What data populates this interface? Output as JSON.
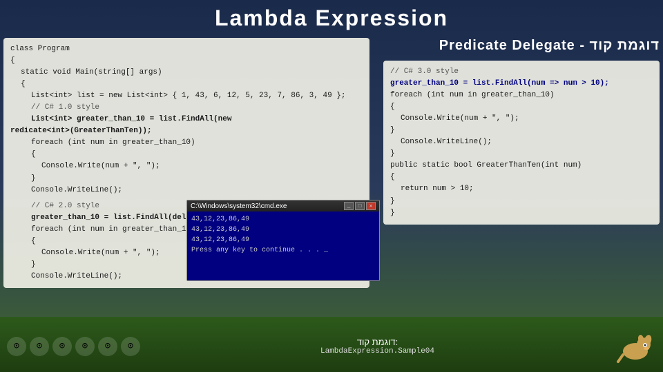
{
  "title": "Lambda  Expression",
  "predicate_header": "Predicate Delegate - דוגמת קוד",
  "left_code": {
    "lines": [
      {
        "text": "class Program",
        "indent": 0,
        "bold": false
      },
      {
        "text": "{",
        "indent": 0,
        "bold": false
      },
      {
        "text": "static void Main(string[] args)",
        "indent": 1,
        "bold": false
      },
      {
        "text": "{",
        "indent": 1,
        "bold": false
      },
      {
        "text": "List<int> list = new List<int> { 1, 43, 6, 12, 5, 23, 7, 86, 3, 49 };",
        "indent": 2,
        "bold": false
      },
      {
        "text": "// C# 1.0 style",
        "indent": 2,
        "bold": false,
        "comment": true
      },
      {
        "text": "List<int> greater_than_10 = list.FindAll(new",
        "indent": 2,
        "bold": true
      },
      {
        "text": "redicate<int>(GreaterThanTen));",
        "indent": 0,
        "bold": true
      },
      {
        "text": "foreach (int num in greater_than_10)",
        "indent": 2,
        "bold": false
      },
      {
        "text": "{",
        "indent": 2,
        "bold": false
      },
      {
        "text": "Console.Write(num + \", \");",
        "indent": 3,
        "bold": false
      },
      {
        "text": "}",
        "indent": 2,
        "bold": false
      },
      {
        "text": "Console.WriteLine();",
        "indent": 2,
        "bold": false
      },
      {
        "text": "",
        "indent": 0,
        "bold": false
      },
      {
        "text": "// C# 2.0 style",
        "indent": 2,
        "bold": false,
        "comment": true
      },
      {
        "text": "greater_than_10 = list.FindAll(delegate(int num) { return num > 10; });",
        "indent": 2,
        "bold": true
      },
      {
        "text": "foreach (int num in greater_than_10)",
        "indent": 2,
        "bold": false
      },
      {
        "text": "{",
        "indent": 2,
        "bold": false
      },
      {
        "text": "Console.Write(num + \", \");",
        "indent": 3,
        "bold": false
      },
      {
        "text": "}",
        "indent": 2,
        "bold": false
      },
      {
        "text": "Console.WriteLine();",
        "indent": 2,
        "bold": false
      }
    ]
  },
  "right_code": {
    "lines": [
      {
        "text": "// C# 3.0 style",
        "comment": true
      },
      {
        "text": "greater_than_10 = list.FindAll(num => num > 10);",
        "bold": true,
        "highlight": true
      },
      {
        "text": "foreach (int num in greater_than_10)",
        "bold": false
      },
      {
        "text": "{",
        "bold": false
      },
      {
        "text": "    Console.Write(num + \", \");",
        "bold": false
      },
      {
        "text": "}",
        "bold": false
      },
      {
        "text": "    Console.WriteLine();",
        "bold": false
      },
      {
        "text": "}",
        "bold": false
      },
      {
        "text": "public static bool GreaterThanTen(int num)",
        "bold": false
      },
      {
        "text": "{",
        "bold": false
      },
      {
        "text": "    return num > 10;",
        "bold": false
      },
      {
        "text": "}",
        "bold": false
      },
      {
        "text": "}",
        "bold": false
      }
    ]
  },
  "cmd_window": {
    "title": "C:\\Windows\\system32\\cmd.exe",
    "content_lines": [
      "43,12,23,86,49",
      "43,12,23,86,49",
      "43,12,23,86,49",
      "Press any key to continue . . . _"
    ]
  },
  "bottom": {
    "icons": [
      "⊙",
      "⊙",
      "⊙",
      "⊙",
      "⊙",
      "⊙"
    ],
    "label": "דוגמת קוד:",
    "sublabel": "LambdaExpression.Sample04"
  }
}
